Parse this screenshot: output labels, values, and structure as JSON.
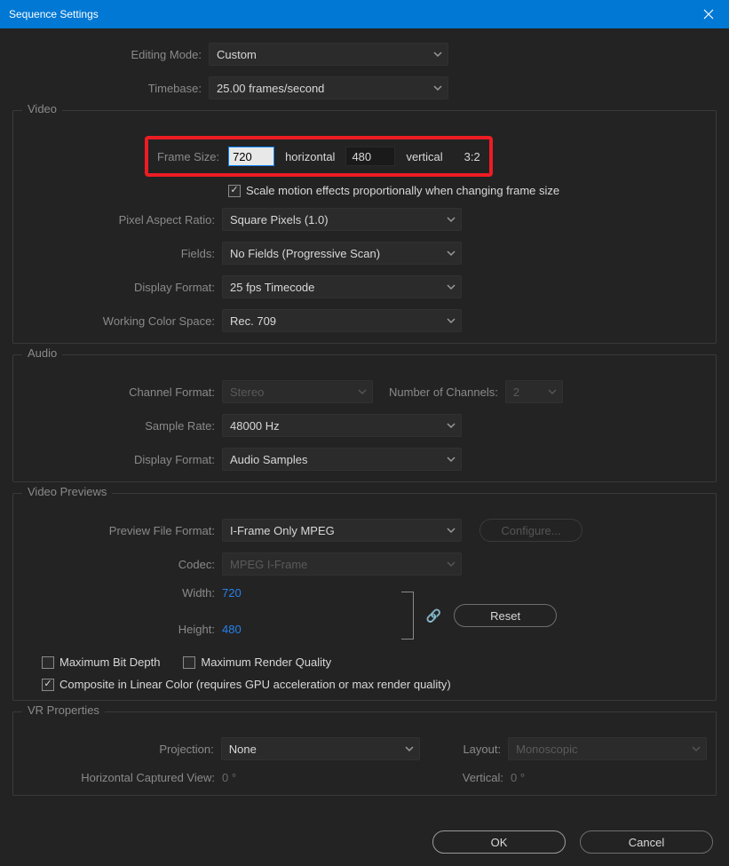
{
  "title": "Sequence Settings",
  "editing_mode": {
    "label": "Editing Mode:",
    "value": "Custom"
  },
  "timebase": {
    "label": "Timebase:",
    "value": "25.00  frames/second"
  },
  "video": {
    "section": "Video",
    "frame_size": {
      "label": "Frame Size:",
      "width": "720",
      "h_label": "horizontal",
      "height": "480",
      "v_label": "vertical",
      "ratio": "3:2"
    },
    "scale_motion": {
      "label": "Scale motion effects proportionally when changing frame size",
      "checked": true
    },
    "pixel_aspect": {
      "label": "Pixel Aspect Ratio:",
      "value": "Square Pixels (1.0)"
    },
    "fields": {
      "label": "Fields:",
      "value": "No Fields (Progressive Scan)"
    },
    "display_format": {
      "label": "Display Format:",
      "value": "25 fps Timecode"
    },
    "color_space": {
      "label": "Working Color Space:",
      "value": "Rec. 709"
    }
  },
  "audio": {
    "section": "Audio",
    "channel_format": {
      "label": "Channel Format:",
      "value": "Stereo"
    },
    "num_channels": {
      "label": "Number of Channels:",
      "value": "2"
    },
    "sample_rate": {
      "label": "Sample Rate:",
      "value": "48000 Hz"
    },
    "display_format": {
      "label": "Display Format:",
      "value": "Audio Samples"
    }
  },
  "previews": {
    "section": "Video Previews",
    "file_format": {
      "label": "Preview File Format:",
      "value": "I-Frame Only MPEG"
    },
    "configure": "Configure...",
    "codec": {
      "label": "Codec:",
      "value": "MPEG I-Frame"
    },
    "width": {
      "label": "Width:",
      "value": "720"
    },
    "height": {
      "label": "Height:",
      "value": "480"
    },
    "reset": "Reset",
    "max_bit_depth": {
      "label": "Maximum Bit Depth",
      "checked": false
    },
    "max_render_quality": {
      "label": "Maximum Render Quality",
      "checked": false
    },
    "composite_linear": {
      "label": "Composite in Linear Color (requires GPU acceleration or max render quality)",
      "checked": true
    }
  },
  "vr": {
    "section": "VR Properties",
    "projection": {
      "label": "Projection:",
      "value": "None"
    },
    "layout": {
      "label": "Layout:",
      "value": "Monoscopic"
    },
    "horiz_view": {
      "label": "Horizontal Captured View:",
      "value": "0 °"
    },
    "vertical": {
      "label": "Vertical:",
      "value": "0 °"
    }
  },
  "footer": {
    "ok": "OK",
    "cancel": "Cancel"
  }
}
